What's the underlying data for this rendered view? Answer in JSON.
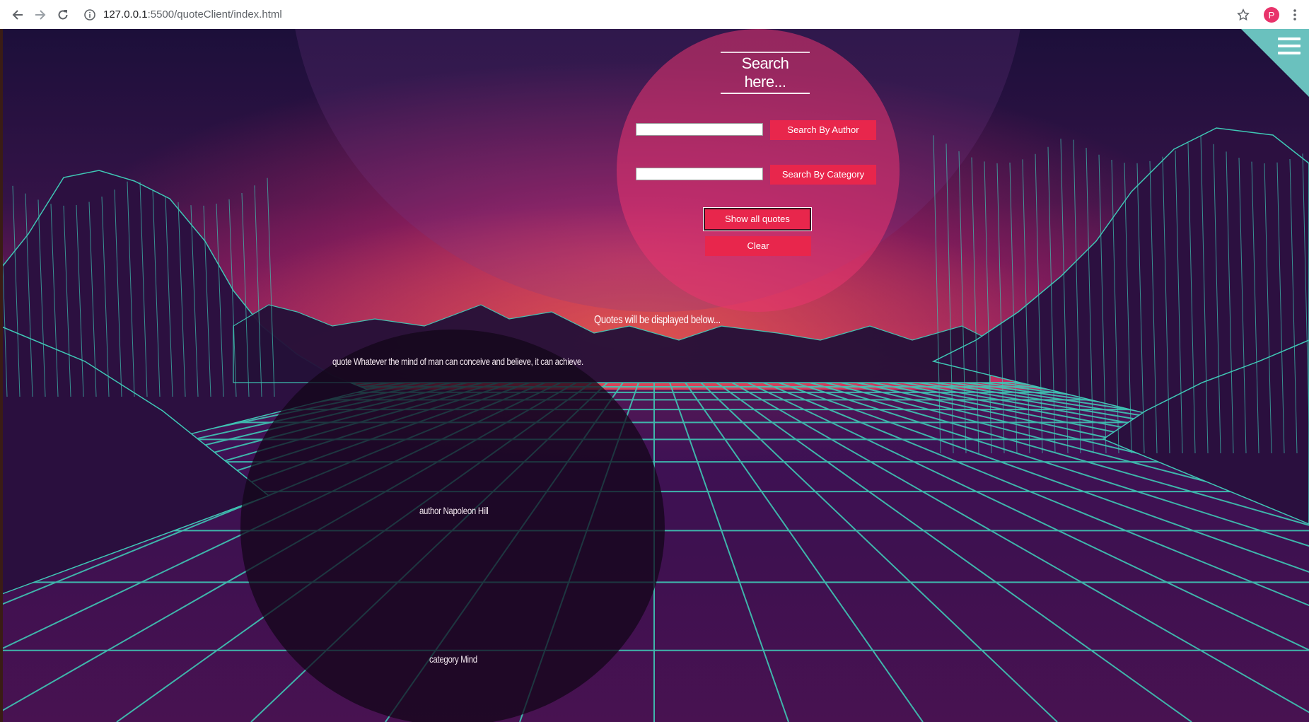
{
  "browser": {
    "url_host": "127.0.0.1",
    "url_rest": ":5500/quoteClient/index.html",
    "profile_initial": "P"
  },
  "search": {
    "title": "Search here...",
    "author_input_value": "",
    "category_input_value": "",
    "author_button": "Search By Author",
    "category_button": "Search By Category",
    "show_all_button": "Show all quotes",
    "clear_button": "Clear"
  },
  "results": {
    "heading": "Quotes will be displayed below...",
    "quote_text": "quote Whatever the mind of man can conceive and believe, it can achieve.",
    "author_text": "author Napoleon Hill",
    "category_text": "category Mind"
  },
  "colors": {
    "accent_red": "#e8264c",
    "panel_pink": "#e93470",
    "grid_teal": "#3fc7b5",
    "menu_triangle": "#6fcbc5"
  },
  "icons": [
    "back-arrow-icon",
    "forward-arrow-icon",
    "reload-icon",
    "info-icon",
    "star-icon",
    "menu-dots-icon",
    "hamburger-menu-icon"
  ]
}
